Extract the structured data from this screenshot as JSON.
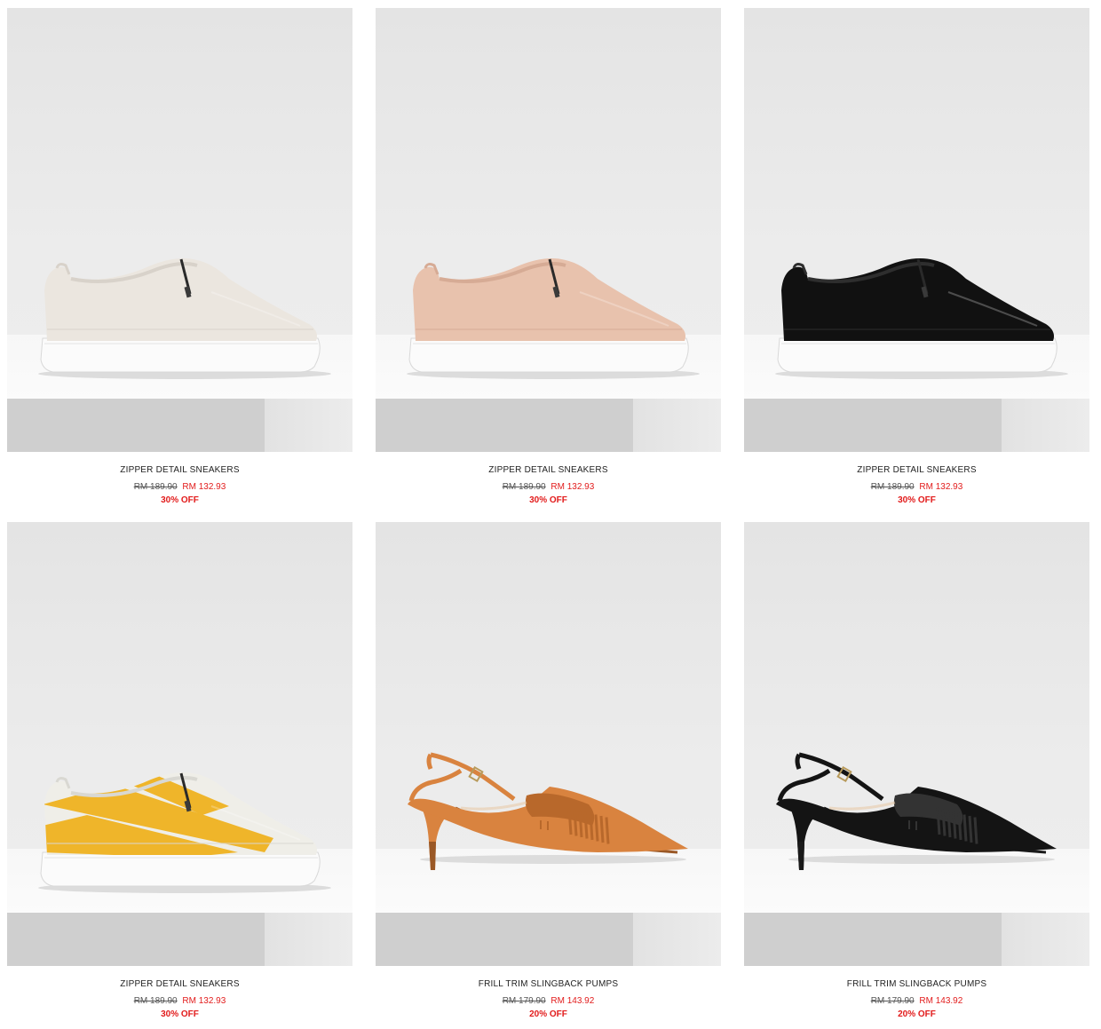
{
  "products": [
    {
      "name": "ZIPPER DETAIL SNEAKERS",
      "old_price": "RM 189.90",
      "new_price": "RM 132.93",
      "discount": "30% OFF",
      "icon": "white-zipper-sneaker-image",
      "colors": {
        "upper": "#ebe6df",
        "shade": "#d8d2ca",
        "sole": "#fbfbfb",
        "stripe": ""
      }
    },
    {
      "name": "ZIPPER DETAIL SNEAKERS",
      "old_price": "RM 189.90",
      "new_price": "RM 132.93",
      "discount": "30% OFF",
      "icon": "nude-zipper-sneaker-image",
      "colors": {
        "upper": "#e8c2ad",
        "shade": "#d6ab95",
        "sole": "#fbfbfb",
        "stripe": ""
      }
    },
    {
      "name": "ZIPPER DETAIL SNEAKERS",
      "old_price": "RM 189.90",
      "new_price": "RM 132.93",
      "discount": "30% OFF",
      "icon": "black-zipper-sneaker-image",
      "colors": {
        "upper": "#111111",
        "shade": "#2e2e2e",
        "sole": "#fbfbfb",
        "stripe": ""
      }
    },
    {
      "name": "ZIPPER DETAIL SNEAKERS",
      "old_price": "RM 189.90",
      "new_price": "RM 132.93",
      "discount": "30% OFF",
      "icon": "yellow-stripe-zipper-sneaker-image",
      "colors": {
        "upper": "#efeee8",
        "shade": "#d9d8d2",
        "sole": "#fbfbfb",
        "stripe": "#efb52a"
      }
    },
    {
      "name": "FRILL TRIM SLINGBACK PUMPS",
      "old_price": "RM 179.90",
      "new_price": "RM 143.92",
      "discount": "20% OFF",
      "icon": "tan-slingback-pump-image",
      "colors": {
        "upper": "#d9833f",
        "shade": "#b8682b",
        "sole": "#9a5826",
        "stripe": ""
      }
    },
    {
      "name": "FRILL TRIM SLINGBACK PUMPS",
      "old_price": "RM 179.90",
      "new_price": "RM 143.92",
      "discount": "20% OFF",
      "icon": "black-slingback-pump-image",
      "colors": {
        "upper": "#141414",
        "shade": "#333333",
        "sole": "#1a1a1a",
        "stripe": ""
      }
    }
  ]
}
